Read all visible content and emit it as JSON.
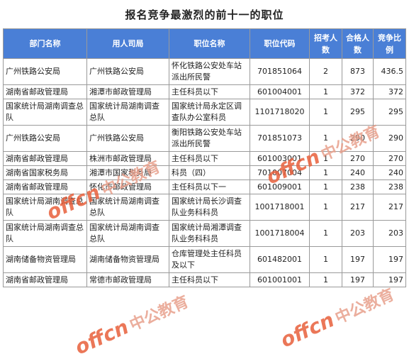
{
  "title": "报名竞争最激烈的前十一的职位",
  "columns": [
    "部门名称",
    "用人司局",
    "职位名称",
    "职位代码",
    "招考人数",
    "合格人数",
    "竞争比例"
  ],
  "rows": [
    [
      "广州铁路公安局",
      "广州铁路公安局",
      "怀化铁路公安处车站派出所民警",
      "701851064",
      "2",
      "873",
      "436.5"
    ],
    [
      "湖南省邮政管理局",
      "湘潭市邮政管理局",
      "主任科员以下",
      "601004001",
      "1",
      "372",
      "372"
    ],
    [
      "国家统计局湖南调查总队",
      "国家统计局湖南调查总队",
      "国家统计局永定区调查队办公室科员",
      "1101718020",
      "1",
      "295",
      "295"
    ],
    [
      "广州铁路公安局",
      "广州铁路公安局",
      "衡阳铁路公安处车站派出所民警",
      "701851073",
      "1",
      "290",
      "290"
    ],
    [
      "湖南省邮政管理局",
      "株洲市邮政管理局",
      "主任科员以下",
      "601003001",
      "1",
      "270",
      "270"
    ],
    [
      "湖南省国家税务局",
      "湘潭市国家税务局",
      "科员（四）",
      "701007004",
      "1",
      "240",
      "240"
    ],
    [
      "湖南省邮政管理局",
      "怀化市邮政管理局",
      "主任科员以下一",
      "601009001",
      "1",
      "238",
      "238"
    ],
    [
      "国家统计局湖南调查总队",
      "国家统计局湖南调查总队",
      "国家统计局长沙调查队业务科科员",
      "1001718001",
      "1",
      "217",
      "217"
    ],
    [
      "国家统计局湖南调查总队",
      "国家统计局湖南调查总队",
      "国家统计局湘潭调查队业务科科员",
      "1001718004",
      "1",
      "203",
      "203"
    ],
    [
      "湖南储备物资管理局",
      "湖南储备物资管理局",
      "仓库管理处主任科员及以下",
      "601482001",
      "1",
      "197",
      "197"
    ],
    [
      "湖南省邮政管理局",
      "常德市邮政管理局",
      "主任科员以下",
      "601001001",
      "1",
      "197",
      "197"
    ]
  ],
  "watermark": {
    "brand": "offcn",
    "cn": "中公教育"
  }
}
